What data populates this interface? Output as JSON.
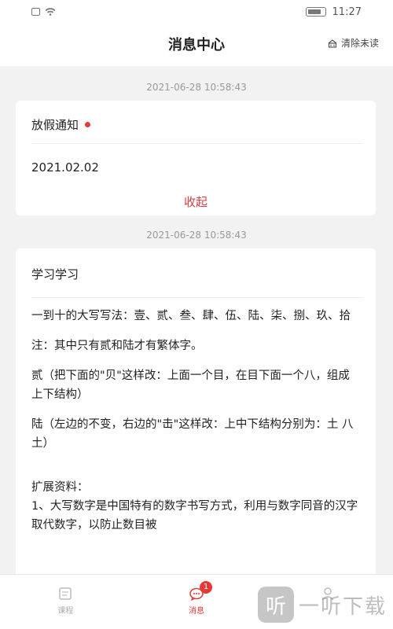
{
  "status_bar": {
    "time": "11:27"
  },
  "header": {
    "title": "消息中心",
    "clear_label": "清除未读"
  },
  "messages": [
    {
      "timestamp": "2021-06-28 10:58:43",
      "title": "放假通知",
      "unread": true,
      "body": "2021.02.02",
      "collapse_label": "收起"
    },
    {
      "timestamp": "2021-06-28 10:58:43",
      "title": "学习学习",
      "paragraphs": [
        "一到十的大写写法：壹、贰、叁、肆、伍、陆、柒、捌、玖、拾",
        "注：其中只有贰和陆才有繁体字。",
        "贰（把下面的\"贝\"这样改：上面一个目，在目下面一个八，组成上下结构）",
        "陆（左边的不变，右边的\"击\"这样改：上中下结构分别为：土 八 土）",
        "扩展资料：",
        "1、大写数字是中国特有的数字书写方式，利用与数字同音的汉字取代数字，以防止数目被"
      ]
    }
  ],
  "tabs": [
    {
      "label": "课程",
      "icon": "book-icon",
      "active": false
    },
    {
      "label": "消息",
      "icon": "chat-icon",
      "active": true,
      "badge": "1"
    },
    {
      "label": "",
      "icon": "user-icon",
      "active": false
    }
  ],
  "watermark": {
    "glyph": "听",
    "text": "一听下载"
  },
  "colors": {
    "accent": "#e53935",
    "background": "#f2f2f2"
  }
}
